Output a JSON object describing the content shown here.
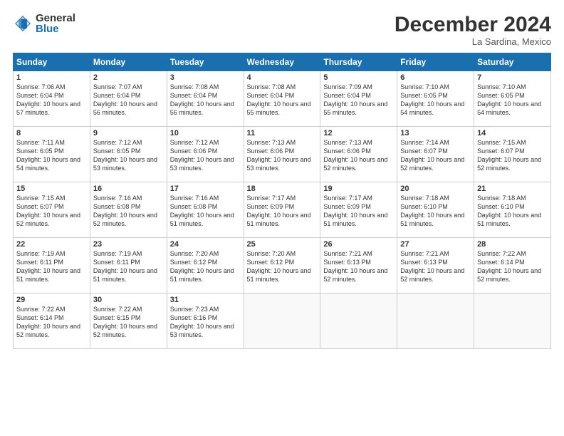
{
  "logo": {
    "general": "General",
    "blue": "Blue"
  },
  "title": "December 2024",
  "location": "La Sardina, Mexico",
  "headers": [
    "Sunday",
    "Monday",
    "Tuesday",
    "Wednesday",
    "Thursday",
    "Friday",
    "Saturday"
  ],
  "weeks": [
    [
      {
        "day": "1",
        "sunrise": "Sunrise: 7:06 AM",
        "sunset": "Sunset: 6:04 PM",
        "daylight": "Daylight: 10 hours and 57 minutes."
      },
      {
        "day": "2",
        "sunrise": "Sunrise: 7:07 AM",
        "sunset": "Sunset: 6:04 PM",
        "daylight": "Daylight: 10 hours and 56 minutes."
      },
      {
        "day": "3",
        "sunrise": "Sunrise: 7:08 AM",
        "sunset": "Sunset: 6:04 PM",
        "daylight": "Daylight: 10 hours and 56 minutes."
      },
      {
        "day": "4",
        "sunrise": "Sunrise: 7:08 AM",
        "sunset": "Sunset: 6:04 PM",
        "daylight": "Daylight: 10 hours and 55 minutes."
      },
      {
        "day": "5",
        "sunrise": "Sunrise: 7:09 AM",
        "sunset": "Sunset: 6:04 PM",
        "daylight": "Daylight: 10 hours and 55 minutes."
      },
      {
        "day": "6",
        "sunrise": "Sunrise: 7:10 AM",
        "sunset": "Sunset: 6:05 PM",
        "daylight": "Daylight: 10 hours and 54 minutes."
      },
      {
        "day": "7",
        "sunrise": "Sunrise: 7:10 AM",
        "sunset": "Sunset: 6:05 PM",
        "daylight": "Daylight: 10 hours and 54 minutes."
      }
    ],
    [
      {
        "day": "8",
        "sunrise": "Sunrise: 7:11 AM",
        "sunset": "Sunset: 6:05 PM",
        "daylight": "Daylight: 10 hours and 54 minutes."
      },
      {
        "day": "9",
        "sunrise": "Sunrise: 7:12 AM",
        "sunset": "Sunset: 6:05 PM",
        "daylight": "Daylight: 10 hours and 53 minutes."
      },
      {
        "day": "10",
        "sunrise": "Sunrise: 7:12 AM",
        "sunset": "Sunset: 6:06 PM",
        "daylight": "Daylight: 10 hours and 53 minutes."
      },
      {
        "day": "11",
        "sunrise": "Sunrise: 7:13 AM",
        "sunset": "Sunset: 6:06 PM",
        "daylight": "Daylight: 10 hours and 53 minutes."
      },
      {
        "day": "12",
        "sunrise": "Sunrise: 7:13 AM",
        "sunset": "Sunset: 6:06 PM",
        "daylight": "Daylight: 10 hours and 52 minutes."
      },
      {
        "day": "13",
        "sunrise": "Sunrise: 7:14 AM",
        "sunset": "Sunset: 6:07 PM",
        "daylight": "Daylight: 10 hours and 52 minutes."
      },
      {
        "day": "14",
        "sunrise": "Sunrise: 7:15 AM",
        "sunset": "Sunset: 6:07 PM",
        "daylight": "Daylight: 10 hours and 52 minutes."
      }
    ],
    [
      {
        "day": "15",
        "sunrise": "Sunrise: 7:15 AM",
        "sunset": "Sunset: 6:07 PM",
        "daylight": "Daylight: 10 hours and 52 minutes."
      },
      {
        "day": "16",
        "sunrise": "Sunrise: 7:16 AM",
        "sunset": "Sunset: 6:08 PM",
        "daylight": "Daylight: 10 hours and 52 minutes."
      },
      {
        "day": "17",
        "sunrise": "Sunrise: 7:16 AM",
        "sunset": "Sunset: 6:08 PM",
        "daylight": "Daylight: 10 hours and 51 minutes."
      },
      {
        "day": "18",
        "sunrise": "Sunrise: 7:17 AM",
        "sunset": "Sunset: 6:09 PM",
        "daylight": "Daylight: 10 hours and 51 minutes."
      },
      {
        "day": "19",
        "sunrise": "Sunrise: 7:17 AM",
        "sunset": "Sunset: 6:09 PM",
        "daylight": "Daylight: 10 hours and 51 minutes."
      },
      {
        "day": "20",
        "sunrise": "Sunrise: 7:18 AM",
        "sunset": "Sunset: 6:10 PM",
        "daylight": "Daylight: 10 hours and 51 minutes."
      },
      {
        "day": "21",
        "sunrise": "Sunrise: 7:18 AM",
        "sunset": "Sunset: 6:10 PM",
        "daylight": "Daylight: 10 hours and 51 minutes."
      }
    ],
    [
      {
        "day": "22",
        "sunrise": "Sunrise: 7:19 AM",
        "sunset": "Sunset: 6:11 PM",
        "daylight": "Daylight: 10 hours and 51 minutes."
      },
      {
        "day": "23",
        "sunrise": "Sunrise: 7:19 AM",
        "sunset": "Sunset: 6:11 PM",
        "daylight": "Daylight: 10 hours and 51 minutes."
      },
      {
        "day": "24",
        "sunrise": "Sunrise: 7:20 AM",
        "sunset": "Sunset: 6:12 PM",
        "daylight": "Daylight: 10 hours and 51 minutes."
      },
      {
        "day": "25",
        "sunrise": "Sunrise: 7:20 AM",
        "sunset": "Sunset: 6:12 PM",
        "daylight": "Daylight: 10 hours and 51 minutes."
      },
      {
        "day": "26",
        "sunrise": "Sunrise: 7:21 AM",
        "sunset": "Sunset: 6:13 PM",
        "daylight": "Daylight: 10 hours and 52 minutes."
      },
      {
        "day": "27",
        "sunrise": "Sunrise: 7:21 AM",
        "sunset": "Sunset: 6:13 PM",
        "daylight": "Daylight: 10 hours and 52 minutes."
      },
      {
        "day": "28",
        "sunrise": "Sunrise: 7:22 AM",
        "sunset": "Sunset: 6:14 PM",
        "daylight": "Daylight: 10 hours and 52 minutes."
      }
    ],
    [
      {
        "day": "29",
        "sunrise": "Sunrise: 7:22 AM",
        "sunset": "Sunset: 6:14 PM",
        "daylight": "Daylight: 10 hours and 52 minutes."
      },
      {
        "day": "30",
        "sunrise": "Sunrise: 7:22 AM",
        "sunset": "Sunset: 6:15 PM",
        "daylight": "Daylight: 10 hours and 52 minutes."
      },
      {
        "day": "31",
        "sunrise": "Sunrise: 7:23 AM",
        "sunset": "Sunset: 6:16 PM",
        "daylight": "Daylight: 10 hours and 53 minutes."
      },
      null,
      null,
      null,
      null
    ]
  ]
}
